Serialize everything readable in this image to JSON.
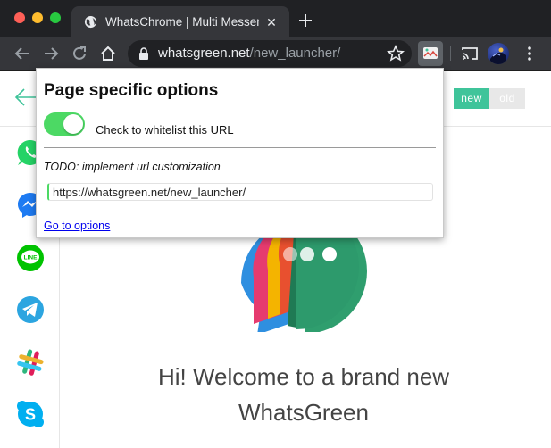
{
  "browser": {
    "tab": {
      "title": "WhatsChrome | Multi Messenger",
      "close_glyph": "✕"
    },
    "url": {
      "host": "whatsgreen.net",
      "path": "/new_launcher/"
    }
  },
  "page": {
    "version_toggle": {
      "new_label": "new",
      "old_label": "old",
      "active_color": "#3fc49a"
    },
    "sidebar_apps": [
      "whatsapp-icon",
      "messenger-icon",
      "line-icon",
      "telegram-icon",
      "slack-icon",
      "skype-icon"
    ],
    "welcome_line1": "Hi! Welcome to a brand new",
    "welcome_line2": "WhatsGreen"
  },
  "popup": {
    "title": "Page specific options",
    "whitelist_label": "Check to whitelist this URL",
    "whitelist_checked": true,
    "todo_text": "TODO: implement url customization",
    "url_value": "https://whatsgreen.net/new_launcher/",
    "options_link": "Go to options"
  }
}
